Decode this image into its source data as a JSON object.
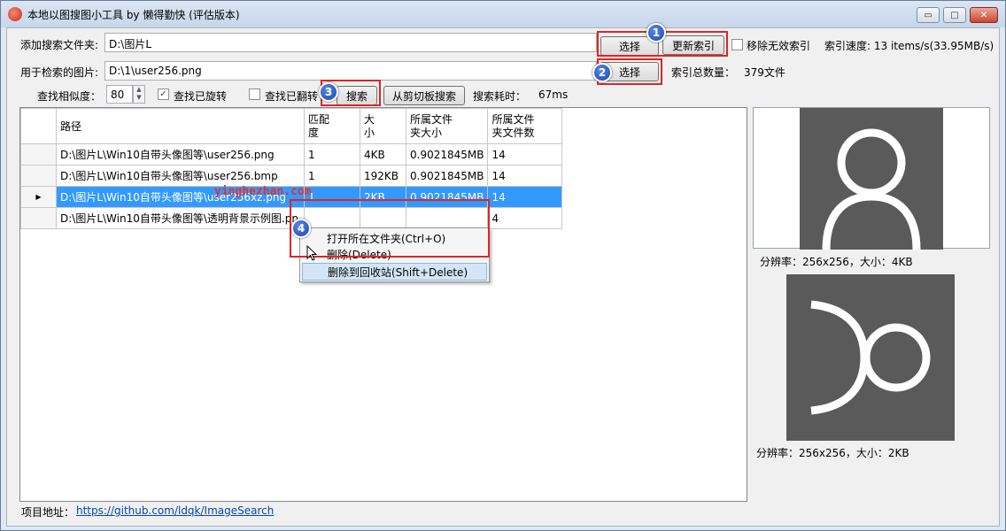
{
  "window": {
    "title": "本地以图搜图小工具 by 懒得勤快 (评估版本)",
    "minimize": "▭",
    "maximize": "□",
    "close": "✕"
  },
  "row1": {
    "label": "添加搜索文件夹:",
    "folder_value": "D:\\图片L",
    "select_button": "选择",
    "reindex_button": "更新索引",
    "remove_invalid_label": "移除无效索引",
    "remove_invalid_checked": false,
    "index_speed": "索引速度: 13 items/s(33.95MB/s)"
  },
  "row2": {
    "label": "用于检索的图片:",
    "image_value": "D:\\1\\user256.png",
    "select_button": "选择",
    "index_total_label": "索引总数量：",
    "index_total_value": "379文件"
  },
  "row3": {
    "similarity_label": "查找相似度：",
    "similarity_value": "80",
    "find_rotated_label": "查找已旋转",
    "find_rotated_checked": true,
    "find_flipped_label": "查找已翻转",
    "find_flipped_checked": false,
    "search_button": "搜索",
    "clipboard_button": "从剪切板搜索",
    "elapsed_label": "搜索耗时：",
    "elapsed_value": "67ms"
  },
  "badges": [
    "1",
    "2",
    "3",
    "4"
  ],
  "table": {
    "headers": {
      "path": "路径",
      "match": [
        "匹配",
        "度"
      ],
      "size": [
        "大",
        "小"
      ],
      "folder_size": [
        "所属文件",
        "夹大小"
      ],
      "folder_count": [
        "所属文件",
        "夹文件数"
      ]
    },
    "rows": [
      {
        "path": "D:\\图片L\\Win10自带头像图等\\user256.png",
        "match": "1",
        "size": "4KB",
        "folder_size": "0.9021845MB",
        "folder_count": "14"
      },
      {
        "path": "D:\\图片L\\Win10自带头像图等\\user256.bmp",
        "match": "1",
        "size": "192KB",
        "folder_size": "0.9021845MB",
        "folder_count": "14"
      },
      {
        "path": "D:\\图片L\\Win10自带头像图等\\user256xz.png",
        "match": "1",
        "size": "2KB",
        "folder_size": "0.9021845MB",
        "folder_count": "14"
      },
      {
        "path": "D:\\图片L\\Win10自带头像图等\\透明背景示例图.pn",
        "match": "",
        "size": "",
        "folder_size": "",
        "folder_count": "4"
      }
    ],
    "selected_row_index": 2
  },
  "watermark": "yinghezhan.com",
  "context_menu": {
    "items": [
      "打开所在文件夹(Ctrl+O)",
      "删除(Delete)",
      "删除到回收站(Shift+Delete)"
    ],
    "highlighted_index": 2
  },
  "previews": [
    {
      "caption": "分辨率：256x256，大小：4KB"
    },
    {
      "caption": "分辨率：256x256，大小：2KB"
    }
  ],
  "footer": {
    "label": "项目地址：",
    "link": "https://github.com/ldqk/ImageSearch"
  },
  "colors": {
    "selection": "#3399ff",
    "highlight_border": "#e02424",
    "badge": "#1646a8",
    "preview_bg": "#5a5a5a"
  },
  "icons": {
    "app": "app-icon",
    "row_pointer": "row-pointer-icon",
    "spinner": "spinner-arrows-icon",
    "user_avatar": "user-avatar-icon",
    "rotated_avatar": "rotated-avatar-icon",
    "cursor": "mouse-cursor-icon"
  }
}
